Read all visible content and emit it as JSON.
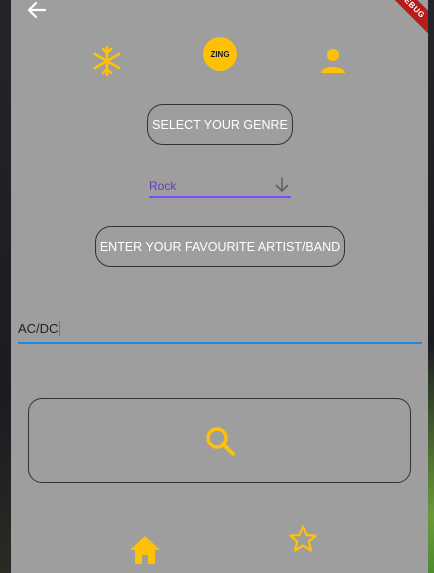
{
  "header": {
    "back_label": "Back"
  },
  "debug_banner": "DEBUG",
  "top_icons": {
    "left": "snowflake-icon",
    "center_logo": "ZING",
    "right": "person-icon"
  },
  "genre": {
    "button_label": "SELECT YOUR GENRE",
    "dropdown_value": "Rock",
    "dropdown_icon": "arrow-down-icon"
  },
  "artist": {
    "button_label": "ENTER YOUR FAVOURITE ARTIST/BAND",
    "input_value": "AC/DC"
  },
  "search": {
    "icon": "search-icon"
  },
  "bottom_nav": {
    "home_icon": "home-icon",
    "favourites_icon": "star-outline-icon"
  },
  "colors": {
    "background": "#9e9e9e",
    "accent": "#ffc107",
    "dropdown_underline": "#7c4dff",
    "input_underline": "#1e88e5"
  }
}
